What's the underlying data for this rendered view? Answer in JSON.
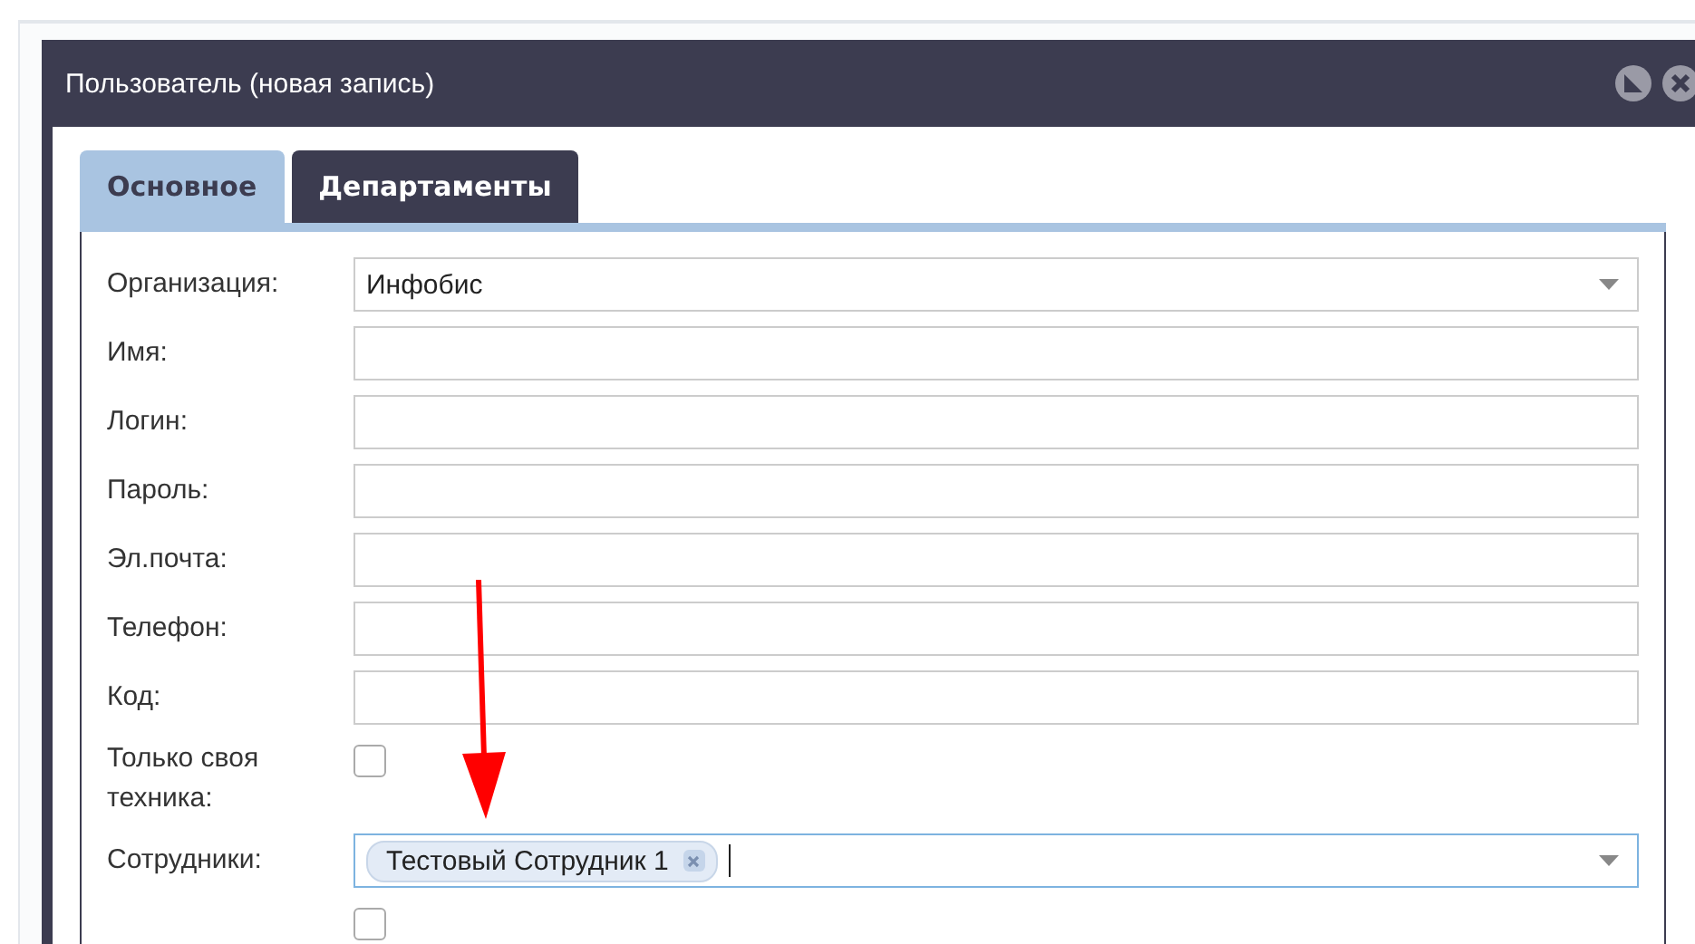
{
  "dialog": {
    "title": "Пользователь (новая запись)"
  },
  "tabs": [
    {
      "label": "Основное",
      "selected": true
    },
    {
      "label": "Департаменты",
      "selected": false
    }
  ],
  "form": {
    "rows": [
      {
        "kind": "select",
        "label": "Организация:",
        "value": "Инфобис"
      },
      {
        "kind": "text",
        "label": "Имя:"
      },
      {
        "kind": "text",
        "label": "Логин:"
      },
      {
        "kind": "text",
        "label": "Пароль:"
      },
      {
        "kind": "text",
        "label": "Эл.почта:"
      },
      {
        "kind": "text",
        "label": "Телефон:"
      },
      {
        "kind": "text",
        "label": "Код:"
      },
      {
        "kind": "checkbox",
        "label": "Только своя техника:",
        "checked": false
      },
      {
        "kind": "tags",
        "label": "Сотрудники:",
        "tags": [
          "Тестовый Сотрудник 1"
        ],
        "focused": true
      },
      {
        "kind": "checkbox",
        "checked": false
      }
    ]
  }
}
